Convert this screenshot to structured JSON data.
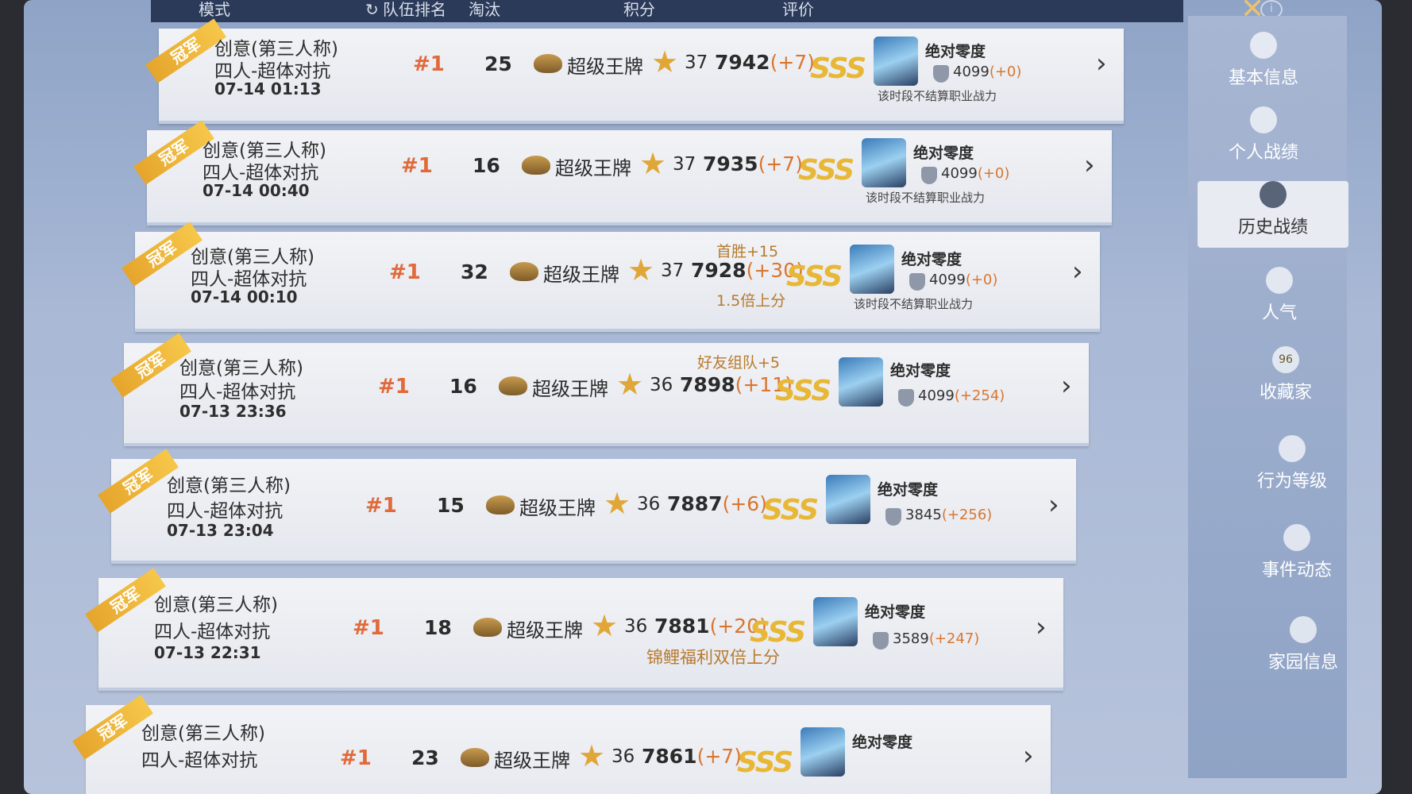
{
  "header": {
    "col_mode": "模式",
    "col_team_rank": "队伍排名",
    "col_eliminations": "淘汰",
    "col_points": "积分",
    "col_rating": "评价"
  },
  "sidebar": {
    "items": [
      {
        "label": "基本信息",
        "icon": "id-card-icon"
      },
      {
        "label": "个人战绩",
        "icon": "stats-doc-icon"
      },
      {
        "label": "历史战绩",
        "icon": "history-doc-icon",
        "active": true
      },
      {
        "label": "人气",
        "icon": "popularity-icon"
      },
      {
        "label": "收藏家",
        "icon": "collector-badge-icon",
        "badge": "96"
      },
      {
        "label": "行为等级",
        "icon": "behavior-shield-icon"
      },
      {
        "label": "事件动态",
        "icon": "event-doc-icon"
      },
      {
        "label": "家园信息",
        "icon": "home-icon"
      }
    ]
  },
  "matches": [
    {
      "ribbon": "冠军",
      "mode_line1": "创意(第三人称)",
      "mode_line2": "四人-超体对抗",
      "time": "07-14 01:13",
      "rank": "#1",
      "eliminations": "25",
      "tier": "超级王牌",
      "stars": "37",
      "score": "7942",
      "delta": "(+7)",
      "note_above": "",
      "note_below": "",
      "rating": "SSS",
      "player": "绝对零度",
      "power": "4099",
      "power_delta": "(+0)",
      "player_note": "该时段不结算职业战力"
    },
    {
      "ribbon": "冠军",
      "mode_line1": "创意(第三人称)",
      "mode_line2": "四人-超体对抗",
      "time": "07-14 00:40",
      "rank": "#1",
      "eliminations": "16",
      "tier": "超级王牌",
      "stars": "37",
      "score": "7935",
      "delta": "(+7)",
      "note_above": "",
      "note_below": "",
      "rating": "SSS",
      "player": "绝对零度",
      "power": "4099",
      "power_delta": "(+0)",
      "player_note": "该时段不结算职业战力"
    },
    {
      "ribbon": "冠军",
      "mode_line1": "创意(第三人称)",
      "mode_line2": "四人-超体对抗",
      "time": "07-14 00:10",
      "rank": "#1",
      "eliminations": "32",
      "tier": "超级王牌",
      "stars": "37",
      "score": "7928",
      "delta": "(+30)",
      "note_above": "首胜+15",
      "note_below": "1.5倍上分",
      "rating": "SSS",
      "player": "绝对零度",
      "power": "4099",
      "power_delta": "(+0)",
      "player_note": "该时段不结算职业战力"
    },
    {
      "ribbon": "冠军",
      "mode_line1": "创意(第三人称)",
      "mode_line2": "四人-超体对抗",
      "time": "07-13 23:36",
      "rank": "#1",
      "eliminations": "16",
      "tier": "超级王牌",
      "stars": "36",
      "score": "7898",
      "delta": "(+11)",
      "note_above": "好友组队+5",
      "note_below": "",
      "rating": "SSS",
      "player": "绝对零度",
      "power": "4099",
      "power_delta": "(+254)",
      "player_note": ""
    },
    {
      "ribbon": "冠军",
      "mode_line1": "创意(第三人称)",
      "mode_line2": "四人-超体对抗",
      "time": "07-13 23:04",
      "rank": "#1",
      "eliminations": "15",
      "tier": "超级王牌",
      "stars": "36",
      "score": "7887",
      "delta": "(+6)",
      "note_above": "",
      "note_below": "",
      "rating": "SSS",
      "player": "绝对零度",
      "power": "3845",
      "power_delta": "(+256)",
      "player_note": ""
    },
    {
      "ribbon": "冠军",
      "mode_line1": "创意(第三人称)",
      "mode_line2": "四人-超体对抗",
      "time": "07-13 22:31",
      "rank": "#1",
      "eliminations": "18",
      "tier": "超级王牌",
      "stars": "36",
      "score": "7881",
      "delta": "(+20)",
      "note_above": "",
      "note_below": "锦鲤福利双倍上分",
      "rating": "SSS",
      "player": "绝对零度",
      "power": "3589",
      "power_delta": "(+247)",
      "player_note": ""
    },
    {
      "ribbon": "冠军",
      "mode_line1": "创意(第三人称)",
      "mode_line2": "四人-超体对抗",
      "time": "",
      "rank": "#1",
      "eliminations": "23",
      "tier": "超级王牌",
      "stars": "36",
      "score": "7861",
      "delta": "(+7)",
      "note_above": "",
      "note_below": "",
      "rating": "SSS",
      "player": "绝对零度",
      "power": "",
      "power_delta": "",
      "player_note": ""
    }
  ]
}
